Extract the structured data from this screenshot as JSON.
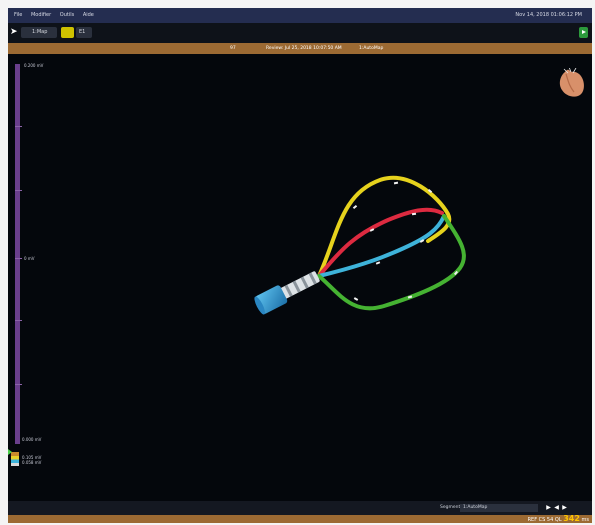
{
  "menubar": {
    "items": [
      "File",
      "Modifier",
      "Outils",
      "Aide"
    ],
    "datetime": "Nov 14, 2018 01:06:12 PM"
  },
  "toolbar": {
    "map_select_value": "1:Map",
    "secondary_select_value": "E1",
    "icon_names": [
      "pointer-icon",
      "play-icon"
    ]
  },
  "titlebar": {
    "left_value": "97",
    "center_text": "Review: Jul 25, 2018 10:07:50 AM",
    "right_text": "1:AutoMap"
  },
  "scale": {
    "top": "0.200 mV",
    "mid": "0 mV",
    "bottom": "0.000 mV",
    "legend1": "0.105 mV",
    "legend2": "0.058 mV"
  },
  "bottombar": {
    "segment_label": "Segment",
    "segment_value": "1:AutoMap"
  },
  "status": {
    "ref": "REF CS",
    "num": "54",
    "ql": "QL",
    "big_value": "342",
    "unit": "ms"
  },
  "colors": {
    "menubar_bg": "#242d50",
    "titlebar_bg": "#9c6a33",
    "scale_bar": "#6a3f8c",
    "spline_yellow": "#e6d21d",
    "spline_red": "#dd2a40",
    "spline_blue": "#3eb3da",
    "spline_green": "#45b232",
    "catheter_body": "#2f9ad4"
  }
}
